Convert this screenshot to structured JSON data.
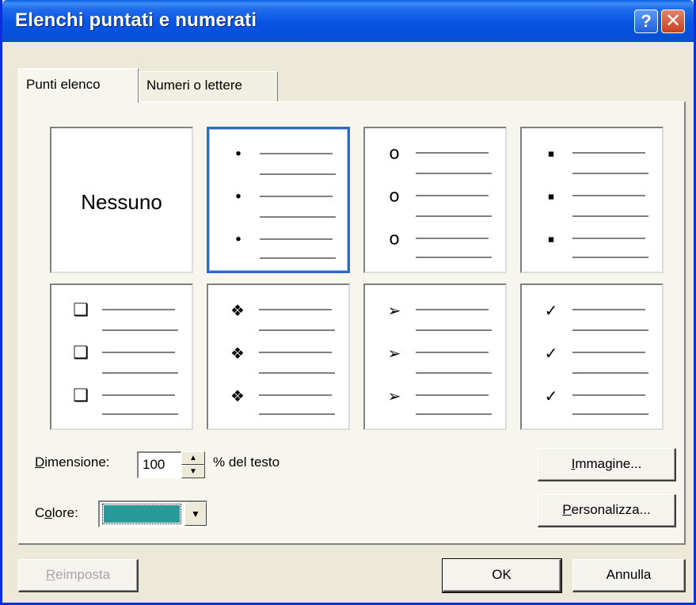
{
  "window": {
    "title": "Elenchi puntati e numerati"
  },
  "titlebar": {
    "help_icon": "?",
    "close_icon": "✕"
  },
  "tabs": [
    {
      "label": "Punti elenco",
      "active": true
    },
    {
      "label": "Numeri o lettere",
      "active": false
    }
  ],
  "gallery": {
    "none_label": "Nessuno",
    "tiles": [
      {
        "icon": "none"
      },
      {
        "icon": "small-dot-bullet",
        "glyph": "•",
        "selected": true
      },
      {
        "icon": "hollow-circle-bullet",
        "glyph": "o"
      },
      {
        "icon": "square-bullet",
        "glyph": "■"
      },
      {
        "icon": "shadowed-box-bullet",
        "glyph": "❑"
      },
      {
        "icon": "four-diamond-bullet",
        "glyph": "❖"
      },
      {
        "icon": "arrowhead-bullet",
        "glyph": "➢"
      },
      {
        "icon": "checkmark-bullet",
        "glyph": "✓"
      }
    ]
  },
  "size": {
    "label": "Dimensione:",
    "accel": "D",
    "value": "100",
    "suffix": "% del testo"
  },
  "color": {
    "label": "Colore:",
    "accel": "o",
    "swatch": "#2a9a98"
  },
  "buttons": {
    "picture": "Immagine...",
    "customize": "Personalizza...",
    "reset": "Reimposta",
    "ok": "OK",
    "cancel": "Annulla"
  }
}
